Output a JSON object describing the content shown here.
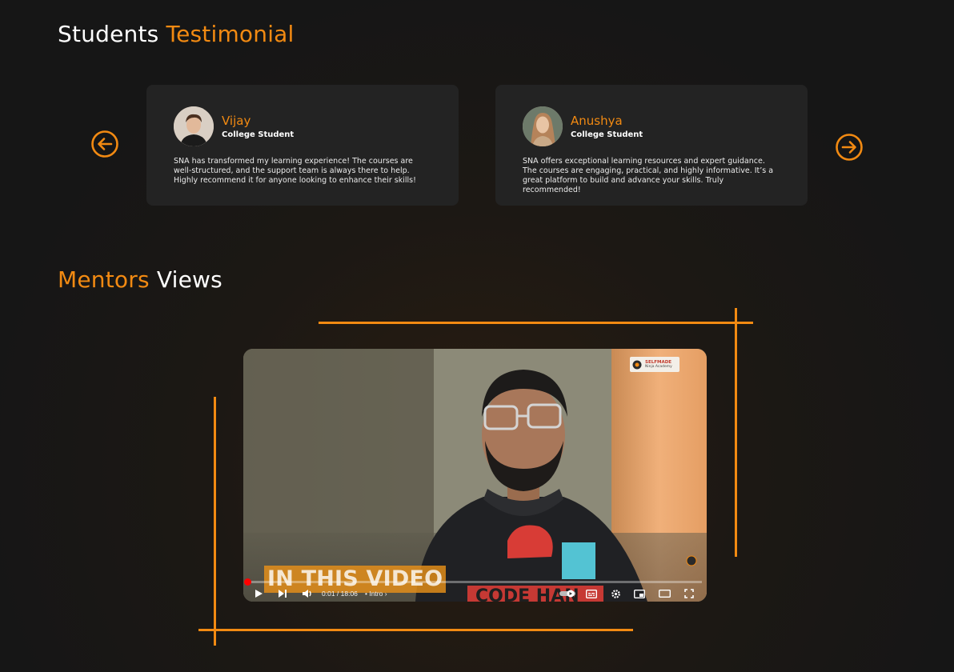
{
  "testimonials": {
    "title_part1": "Students",
    "title_part2": "Testimonial",
    "cards": [
      {
        "name": "Vijay",
        "role": "College Student",
        "text": "SNA  has transformed my learning experience! The courses are well-structured, and the support team is always there to help. Highly recommend it for anyone looking to enhance their skills!"
      },
      {
        "name": "Anushya",
        "role": "College Student",
        "text": "SNA offers exceptional learning resources and expert guidance. The courses are engaging, practical, and highly informative. It’s a great platform to build and advance your skills. Truly recommended!"
      }
    ],
    "prev_icon": "arrow-left-circle-icon",
    "next_icon": "arrow-right-circle-icon"
  },
  "mentors": {
    "title_part1": "Mentors",
    "title_part2": "Views"
  },
  "video": {
    "logo_line1": "SELFMADE",
    "logo_line2": "Ninja Academy",
    "caption": "IN THIS VIDEO",
    "time": "0:01 / 18:06",
    "chapter": "• Intro ›",
    "progress": 0.003,
    "controls": [
      "play-icon",
      "next-icon",
      "volume-icon",
      "autoplay-toggle-icon",
      "subtitles-icon",
      "settings-icon",
      "miniplayer-icon",
      "theater-icon",
      "fullscreen-icon"
    ]
  },
  "colors": {
    "accent": "#f28a12",
    "background": "#171717",
    "card": "#232323"
  }
}
